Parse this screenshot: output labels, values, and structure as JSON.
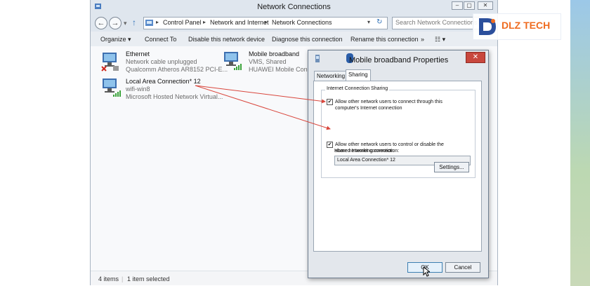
{
  "window": {
    "title": "Network Connections",
    "breadcrumb": [
      "Control Panel",
      "Network and Internet",
      "Network Connections"
    ],
    "search_placeholder": "Search Network Connections",
    "controls": [
      "–",
      "▢",
      "✕"
    ]
  },
  "toolbar": {
    "organize": "Organize",
    "connect_to": "Connect To",
    "disable": "Disable this network device",
    "diagnose": "Diagnose this connection",
    "rename": "Rename this connection"
  },
  "connections": [
    {
      "name": "Ethernet",
      "status": "Network cable unplugged",
      "device": "Qualcomm Atheros AR8152 PCI-E..."
    },
    {
      "name": "Mobile broadband",
      "status": "VMS, Shared",
      "device": "HUAWEI Mobile Connect..."
    },
    {
      "name": "Local Area Connection* 12",
      "status": "wifi-win8",
      "device": "Microsoft Hosted Network Virtual..."
    }
  ],
  "statusbar": {
    "items": "4 items",
    "selected": "1 item selected"
  },
  "dialog": {
    "title": "Mobile broadband Properties",
    "tabs": [
      "Networking",
      "Sharing"
    ],
    "group_label": "Internet Connection Sharing",
    "allow_connect_line1": "Allow other network users to connect through this",
    "allow_connect_line2": "computer's Internet connection",
    "home_label": "Home networking connection:",
    "home_value": "Local Area Connection* 12",
    "allow_control_line1": "Allow other network users to control or disable the",
    "allow_control_line2": "shared Internet connection",
    "allow_connect_checked": true,
    "allow_control_checked": true,
    "settings": "Settings...",
    "ok": "OK",
    "cancel": "Cancel"
  },
  "watermark": {
    "brand": "DLZ TECH"
  },
  "colors": {
    "arrow": "#d9463c",
    "close": "#c8473d",
    "brand": "#ef6b1f"
  }
}
